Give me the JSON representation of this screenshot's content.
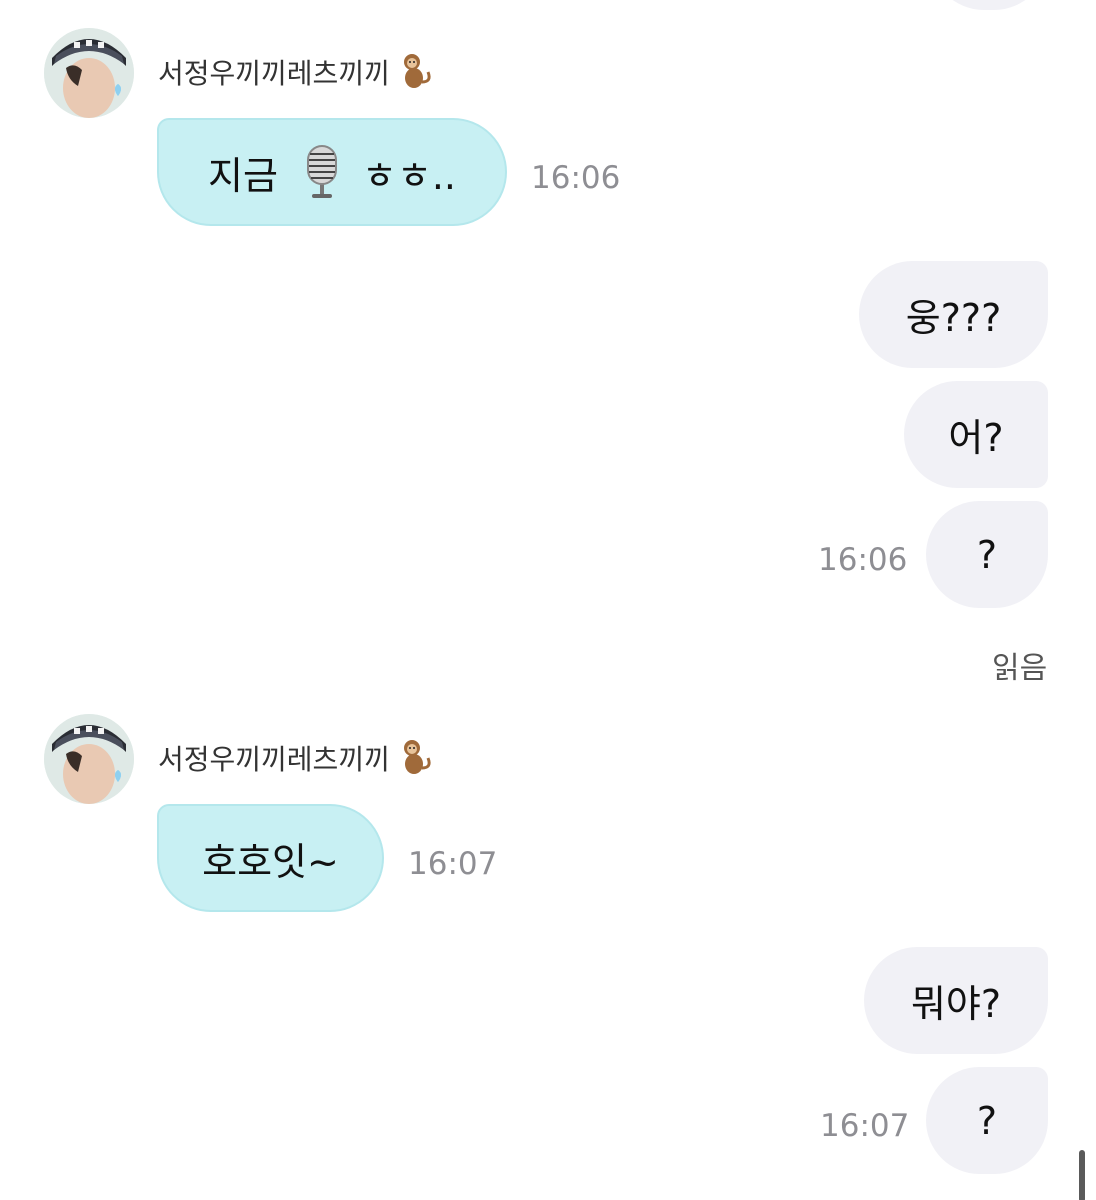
{
  "chat": {
    "group1": {
      "sender_name": "서정우끼끼레츠끼끼",
      "sender_emoji_icon": "monkey-icon",
      "message_prefix": "지금",
      "message_icon": "microphone-icon",
      "message_suffix": "ㅎㅎ..",
      "time": "16:06"
    },
    "outgoing1": {
      "messages": [
        "웅???",
        "어?",
        "?"
      ],
      "time": "16:06",
      "read_label": "읽음"
    },
    "group2": {
      "sender_name": "서정우끼끼레츠끼끼",
      "sender_emoji_icon": "monkey-icon",
      "message": "호호잇~",
      "time": "16:07"
    },
    "outgoing2": {
      "messages": [
        "뭐야?",
        "?"
      ],
      "time": "16:07"
    }
  },
  "colors": {
    "incoming_bubble": "#c8f0f3",
    "outgoing_bubble": "#f1f1f6",
    "timestamp": "#8e8e93"
  }
}
